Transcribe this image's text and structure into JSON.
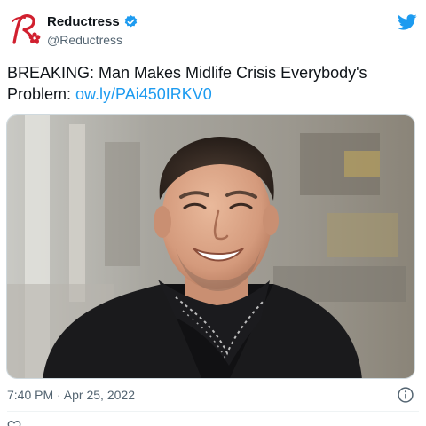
{
  "account": {
    "display_name": "Reductress",
    "handle": "@Reductress",
    "verified": true
  },
  "tweet": {
    "text": "BREAKING: Man Makes Midlife Crisis Everybody's Problem: ",
    "link": "ow.ly/PAi450IRKV0",
    "timestamp": "7:40 PM · Apr 25, 2022"
  },
  "icons": {
    "logo": "reductress-r-logo",
    "verified": "verified-badge-icon",
    "twitter": "twitter-bird-icon",
    "info": "info-icon",
    "like": "heart-icon"
  },
  "colors": {
    "link": "#1d9bf0",
    "twitter_blue": "#1d9bf0",
    "brand_red": "#d1202f",
    "secondary_text": "#536471"
  }
}
